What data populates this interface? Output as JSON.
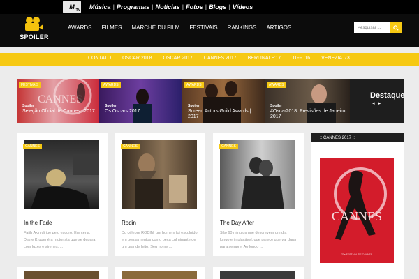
{
  "mtv": {
    "logo": "M",
    "logo_sub": "TV",
    "nav": [
      "Música",
      "Programas",
      "Notícias",
      "Fotos",
      "Blogs",
      "Vídeos"
    ]
  },
  "brand": {
    "name": "SPOILER",
    "accent": "#f6c913"
  },
  "main_nav": [
    "AWARDS",
    "FILMES",
    "MARCHÉ DU FILM",
    "FESTIVAIS",
    "RANKINGS",
    "ARTIGOS"
  ],
  "search": {
    "placeholder": "Pesquisar ..."
  },
  "sub_nav": [
    "CONTATO",
    "OSCAR 2018",
    "OSCAR 2017",
    "CANNES 2017",
    "BERLINALE'17",
    "TIFF '16",
    "VENEZIA '73"
  ],
  "slides": [
    {
      "tag": "FESTIVAIS",
      "category": "Spoiler",
      "title": "Seleção Oficial de Cannes | 2017"
    },
    {
      "tag": "AWARDS",
      "category": "Spoiler",
      "title": "Os Oscars 2017"
    },
    {
      "tag": "AWARDS",
      "category": "Spoiler",
      "title": "Screen Actors Guild Awards | 2017"
    },
    {
      "tag": "AWARDS",
      "category": "Spoiler",
      "title": "#Oscar2018: Previsões de Janeiro, 2017"
    }
  ],
  "destaque": {
    "label": "Destaque",
    "prev": "◂",
    "next": "▸"
  },
  "cards": [
    {
      "tag": "CANNES",
      "title": "In the Fade",
      "excerpt": "Fatih Akin dirige pelo escuro. Em cena, Diane Kruger é a motorista que se depara com luzes e sirenes. ..."
    },
    {
      "tag": "CANNES",
      "title": "Rodin",
      "excerpt": "Do célebre RODIN, um homem foi esculpido em pensamentos como peça culminante de um grande feito. Seu nome ..."
    },
    {
      "tag": "CANNES",
      "title": "The Day After",
      "excerpt": "São 60 minutos que descrevem um dia longo e implacável, que parece que vai durar para sempre. Ao longo ..."
    }
  ],
  "sidebar": {
    "heading": ":: CANNES 2017 ::",
    "poster_text": "CANNES",
    "poster_sub": "70e FESTIVAL DE CANNES"
  }
}
